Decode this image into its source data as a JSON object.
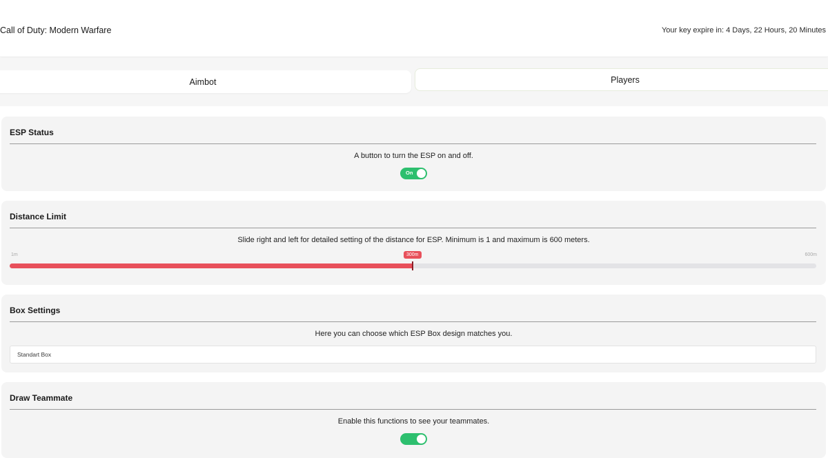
{
  "header": {
    "app_title": "Call of Duty: Modern Warfare",
    "key_expire": "Your key expire in: 4 Days, 22 Hours, 20 Minutes"
  },
  "tabs": [
    {
      "label": "Aimbot",
      "active": false
    },
    {
      "label": "Players",
      "active": true
    }
  ],
  "sections": {
    "esp_status": {
      "title": "ESP Status",
      "description": "A button to turn the ESP on and off.",
      "toggle_label": "On",
      "enabled": true
    },
    "distance_limit": {
      "title": "Distance Limit",
      "description": "Slide right and left for detailed setting of the distance for ESP. Minimum is 1 and maximum is 600 meters.",
      "min_label": "1m",
      "max_label": "600m",
      "value_label": "300m",
      "min": 1,
      "max": 600,
      "value": 300
    },
    "box_settings": {
      "title": "Box Settings",
      "description": "Here you can choose which ESP Box design matches you.",
      "selected": "Standart Box"
    },
    "draw_teammate": {
      "title": "Draw Teammate",
      "description": "Enable this functions to see your teammates.",
      "enabled": true
    }
  },
  "colors": {
    "accent_red": "#e8505b",
    "toggle_green": "#2dbf6e",
    "card_bg": "#f4f4f4"
  }
}
